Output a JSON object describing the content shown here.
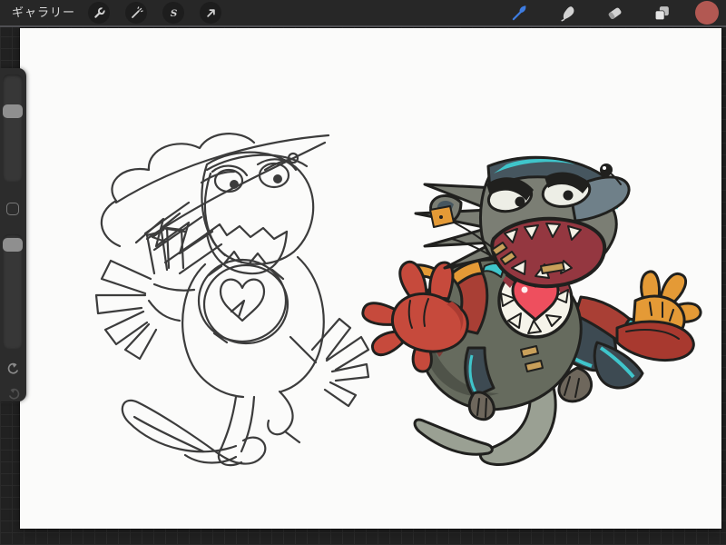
{
  "toolbar": {
    "gallery_label": "ギャラリー",
    "left_tool_icons": [
      "wrench-icon",
      "magic-wand-icon",
      "selection-s-icon",
      "transform-arrow-icon"
    ],
    "right_tool_icons": [
      "paintbrush-icon",
      "smudge-icon",
      "eraser-icon",
      "layers-icon"
    ],
    "selected_tool": "paintbrush",
    "accent_color": "#3e7ce0",
    "color_swatch": "#b25852"
  },
  "sidebar": {
    "controls": [
      "brush-size-slider",
      "modify-button",
      "opacity-slider",
      "undo-button",
      "redo-button"
    ],
    "brush_size_fraction": 0.32,
    "opacity_fraction": 0.04
  },
  "canvas": {
    "artwork": {
      "subject": "Cartoon rat-monster character drawn twice on a white canvas: rough dark pencil sketch on the left, finished flat-color version on the right with gray spiky fur, teal accents, red mitten glove, orange hand, white belly ring of teeth around a red heart, and a long curling rat tail",
      "palette": {
        "ink": "#20201e",
        "sketch": "#3c3c3c",
        "fur-gray": "#7b7e74",
        "fur-dark": "#46565f",
        "teal": "#3fc5cb",
        "snout": "#6f8089",
        "mouth-red": "#943740",
        "teeth": "#f4f2e6",
        "body-olive": "#666b5e",
        "body-shadow": "#4f5349",
        "patch-red": "#7e3b36",
        "glove-red": "#c64a3c",
        "glove-shadow": "#aa3b31",
        "orange": "#e49a36",
        "tan": "#c9a05a",
        "heart-red": "#ee4f5e",
        "belly-white": "#f6f4ea",
        "tail-gray": "#9aa093",
        "paw-gray": "#6e675c",
        "foot-red": "#a8392f",
        "arm-red": "#a93f35",
        "leg-dark": "#3d4a52",
        "eye-white": "#edeee6"
      }
    }
  },
  "ui": {
    "toolbar-bg": "#272727",
    "toolbar-border": "#4e4e52",
    "button-bg": "#1d1d1d",
    "icon-color": "#d2d2d2",
    "background": "#212121",
    "grid-line": "#2b2b2b",
    "panel-bg": "#2c2c2c",
    "track-bg": "#373737",
    "handle-color": "#8f8f8f",
    "canvas-bg": "#fbfbfa",
    "undo-color": "#8a8a8a",
    "redo-color": "#4f4f4f"
  }
}
